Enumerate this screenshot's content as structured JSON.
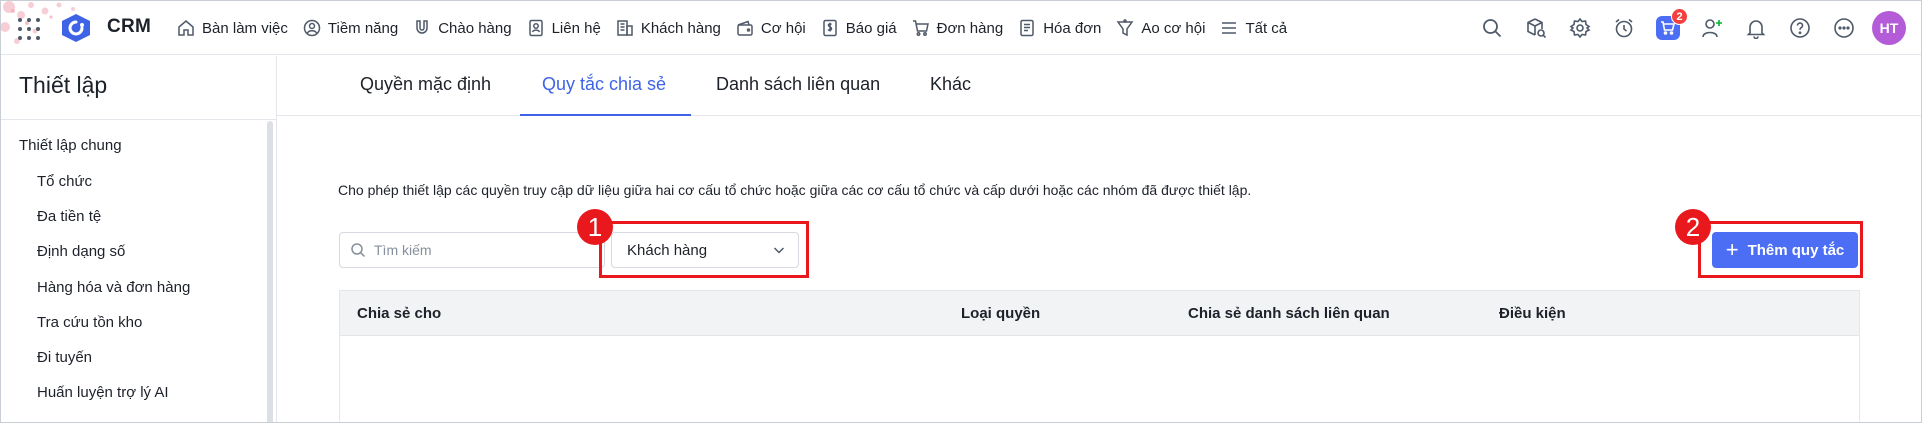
{
  "app": {
    "brand": "CRM"
  },
  "nav": {
    "items": [
      {
        "label": "Bàn làm việc",
        "icon": "home-icon"
      },
      {
        "label": "Tiềm năng",
        "icon": "user-circle-icon"
      },
      {
        "label": "Chào hàng",
        "icon": "magnet-icon"
      },
      {
        "label": "Liên hệ",
        "icon": "contact-icon"
      },
      {
        "label": "Khách hàng",
        "icon": "building-icon"
      },
      {
        "label": "Cơ hội",
        "icon": "wallet-icon"
      },
      {
        "label": "Báo giá",
        "icon": "quote-icon"
      },
      {
        "label": "Đơn hàng",
        "icon": "cart-icon"
      },
      {
        "label": "Hóa đơn",
        "icon": "invoice-icon"
      },
      {
        "label": "Ao cơ hội",
        "icon": "funnel-icon"
      },
      {
        "label": "Tất cả",
        "icon": "menu-icon"
      }
    ],
    "cart_badge": "2",
    "avatar_initials": "HT"
  },
  "sidebar": {
    "title": "Thiết lập",
    "group": "Thiết lập chung",
    "items": [
      "Tổ chức",
      "Đa tiền tệ",
      "Định dạng số",
      "Hàng hóa và đơn hàng",
      "Tra cứu tồn kho",
      "Đi tuyến",
      "Huấn luyện trợ lý AI"
    ]
  },
  "tabs": [
    "Quyền mặc định",
    "Quy tắc chia sẻ",
    "Danh sách liên quan",
    "Khác"
  ],
  "active_tab": "Quy tắc chia sẻ",
  "description": "Cho phép thiết lập các quyền truy cập dữ liệu giữa hai cơ cấu tổ chức hoặc giữa các cơ cấu tổ chức và cấp dưới hoặc các nhóm đã được thiết lập.",
  "search": {
    "placeholder": "Tìm kiếm",
    "value": ""
  },
  "module_select": {
    "value": "Khách hàng"
  },
  "add_button": {
    "label": "Thêm quy tắc"
  },
  "callouts": {
    "one": "1",
    "two": "2"
  },
  "table": {
    "columns": [
      "Chia sẻ cho",
      "Loại quyền",
      "Chia sẻ danh sách liên quan",
      "Điều kiện"
    ],
    "rows": []
  },
  "colors": {
    "accent": "#3f63e6",
    "button": "#4c6ef5",
    "highlight": "#e8181c",
    "avatar": "#b45cd8"
  }
}
